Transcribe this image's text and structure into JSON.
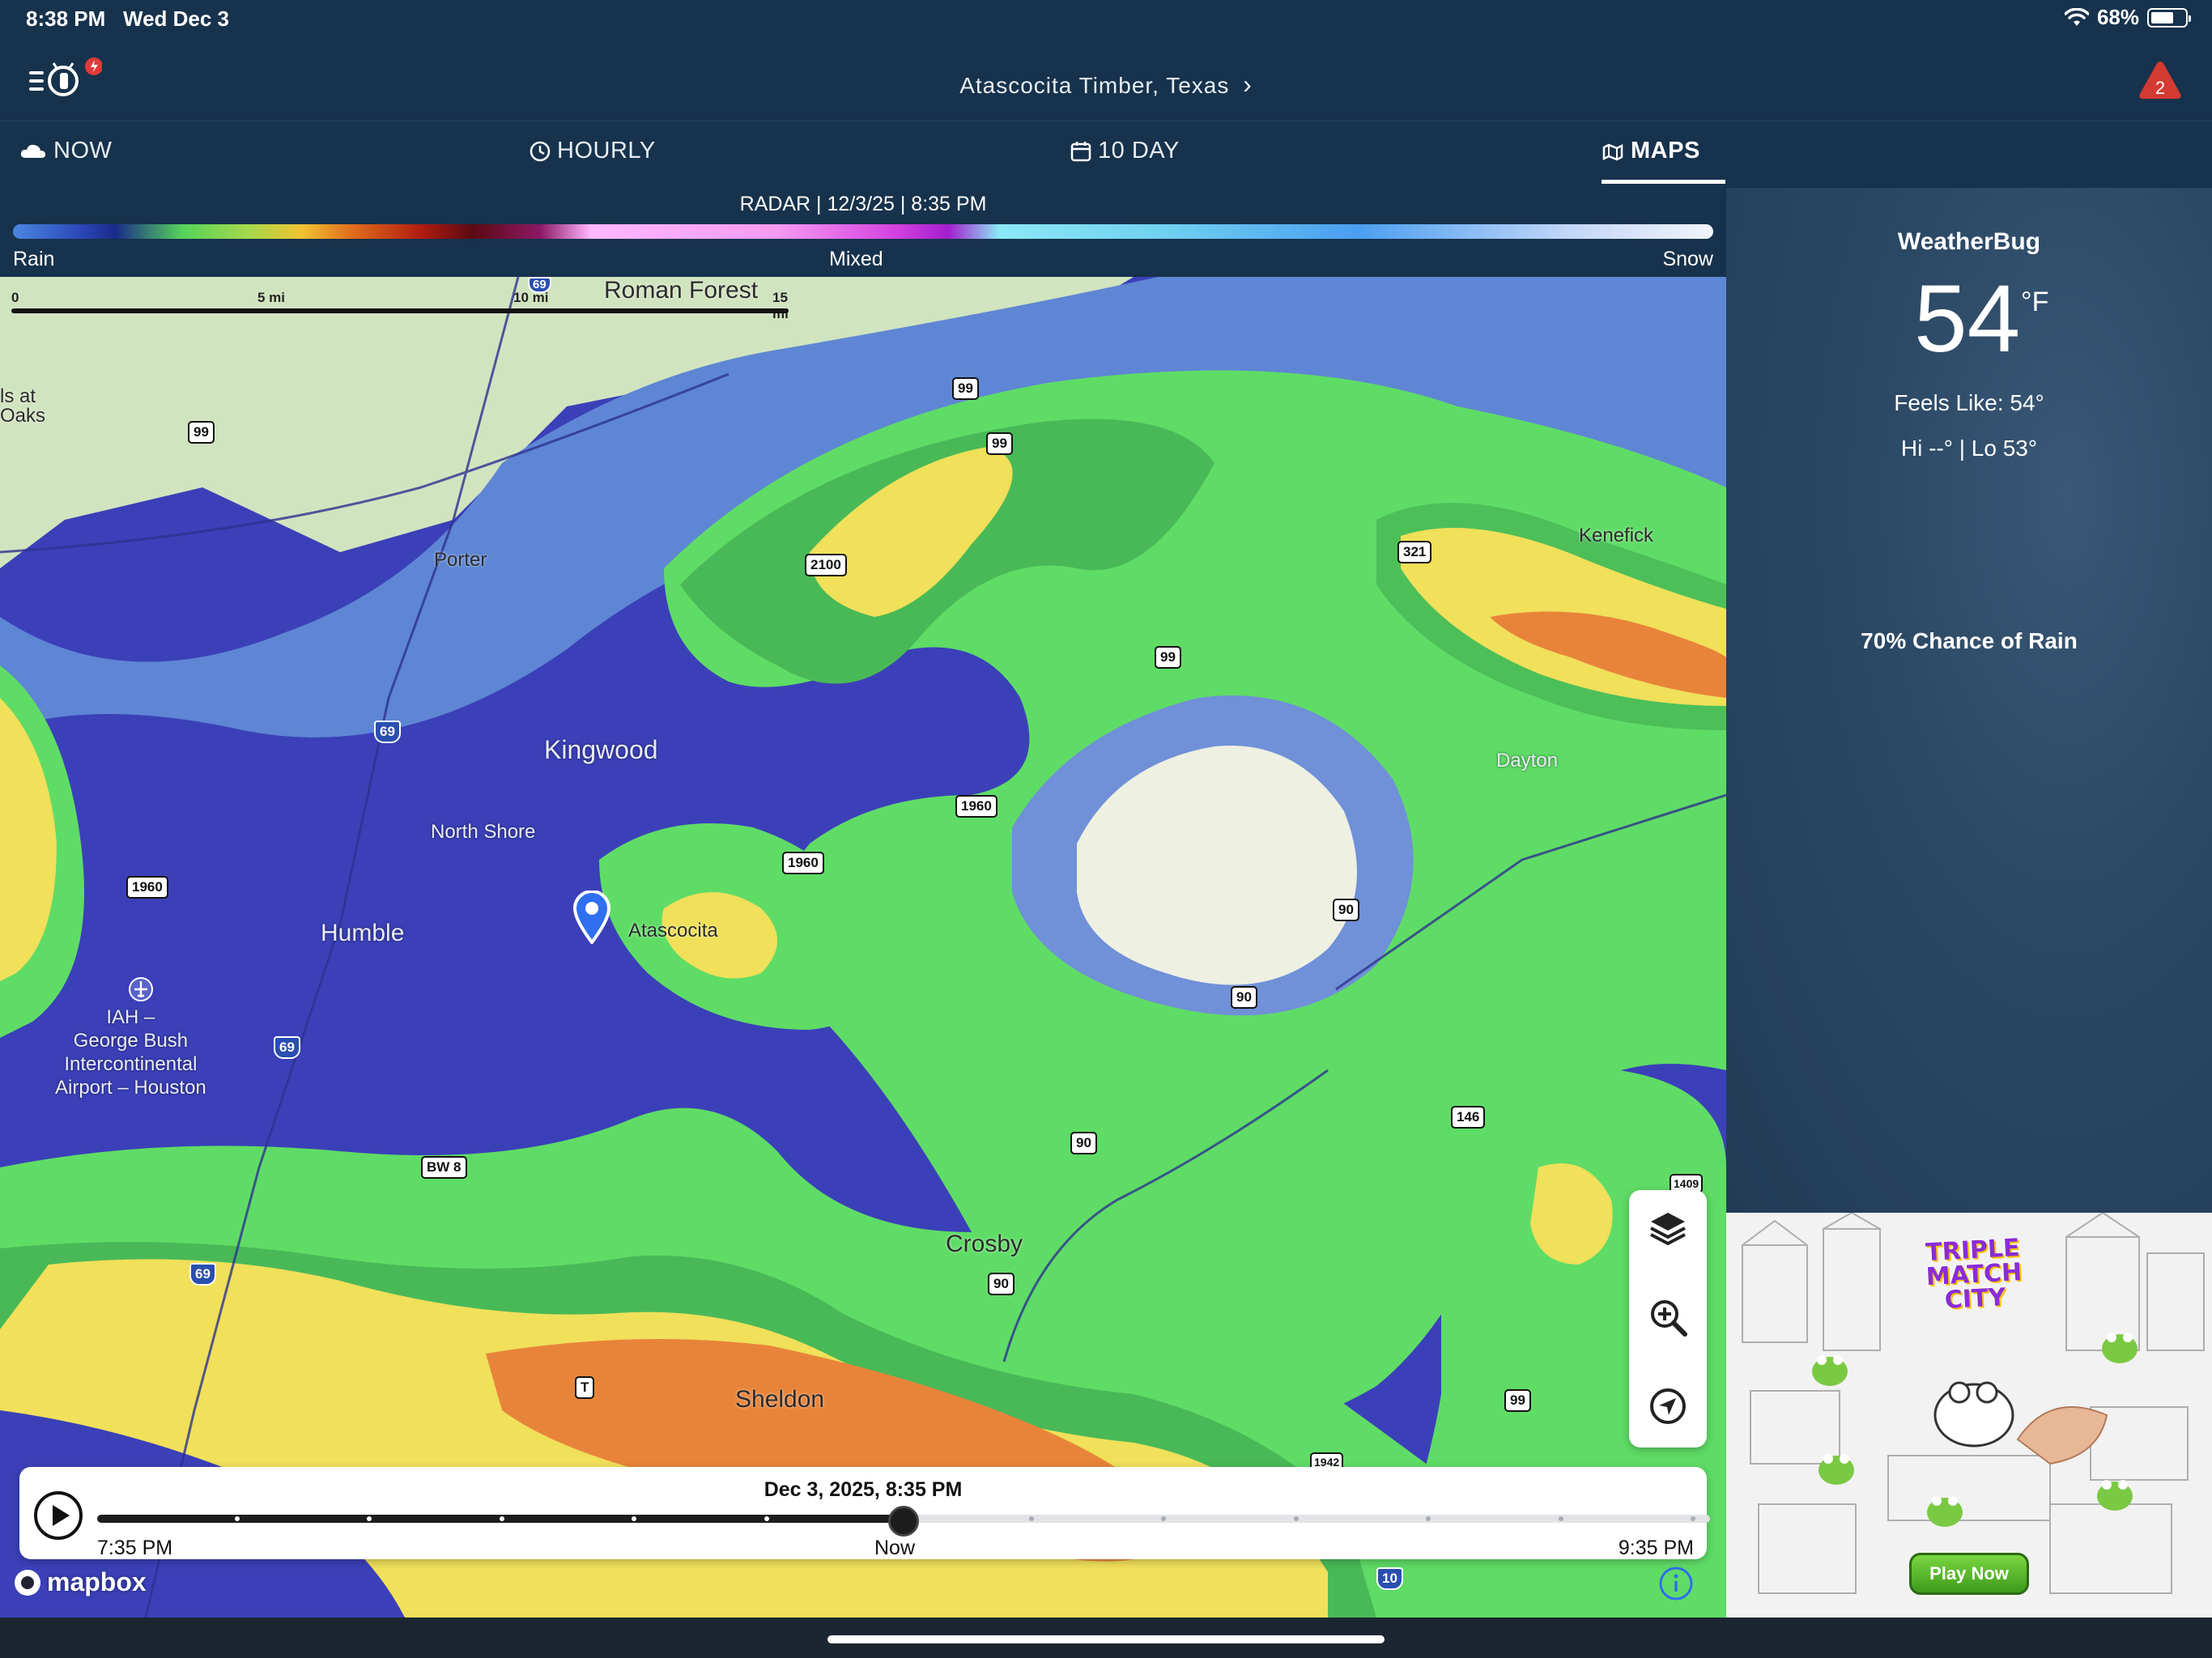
{
  "status_bar": {
    "time": "8:38 PM",
    "date": "Wed Dec 3",
    "battery": "68%",
    "battery_level": 0.68
  },
  "header": {
    "location": "Atascocita Timber, Texas",
    "alert_count": "2"
  },
  "tabs": [
    {
      "label": "NOW",
      "icon": "cloud-icon"
    },
    {
      "label": "HOURLY",
      "icon": "clock-icon"
    },
    {
      "label": "10 DAY",
      "icon": "calendar-icon"
    },
    {
      "label": "MAPS",
      "icon": "map-icon",
      "active": true
    }
  ],
  "radar": {
    "title": "RADAR | 12/3/25 | 8:35 PM",
    "legend": {
      "left": "Rain",
      "center": "Mixed",
      "right": "Snow"
    }
  },
  "scale_bar": {
    "ticks": [
      "0",
      "5 mi",
      "10 mi",
      "15 mi"
    ]
  },
  "map_labels": {
    "roman_forest": "Roman Forest",
    "oaks": "ls at\nOaks",
    "porter": "Porter",
    "kingwood": "Kingwood",
    "north_shore": "North Shore",
    "humble": "Humble",
    "atascocita": "Atascocita",
    "iah": "IAH –\nGeorge Bush\nIntercontinental\nAirport – Houston",
    "kenefick": "Kenefick",
    "dayton": "Dayton",
    "crosby": "Crosby",
    "sheldon": "Sheldon"
  },
  "shields": {
    "s99a": "99",
    "s99b": "99",
    "s99c": "99",
    "s99d": "99",
    "s99e": "99",
    "s2100": "2100",
    "s321": "321",
    "s69a": "69",
    "s69b": "69",
    "s69c": "69",
    "s69d": "69",
    "s1960a": "1960",
    "s1960b": "1960",
    "s1960c": "1960",
    "s90a": "90",
    "s90b": "90",
    "s90c": "90",
    "s90d": "90",
    "s146": "146",
    "sbw8": "BW 8",
    "sT": "T",
    "s10": "10",
    "s1409": "1409",
    "s1942": "1942"
  },
  "timeline": {
    "title": "Dec 3, 2025, 8:35 PM",
    "start": "7:35 PM",
    "now": "Now",
    "end": "9:35 PM",
    "progress": 0.5
  },
  "attribution": "mapbox",
  "side_panel": {
    "brand": "WeatherBug",
    "temperature": "54",
    "unit": "°F",
    "feels_like": "Feels Like: 54°",
    "hi_lo": "Hi --° | Lo 53°",
    "chance": "70% Chance of Rain"
  },
  "ad": {
    "title": "TRIPLE MATCH CITY",
    "cta": "Play Now"
  },
  "colors": {
    "header_bg": "#17324c",
    "radar_light_rain": "#5cd46a",
    "radar_moderate": "#f0dc50",
    "radar_heavy": "#e8843a",
    "radar_very_light": "#3a3fb4"
  }
}
